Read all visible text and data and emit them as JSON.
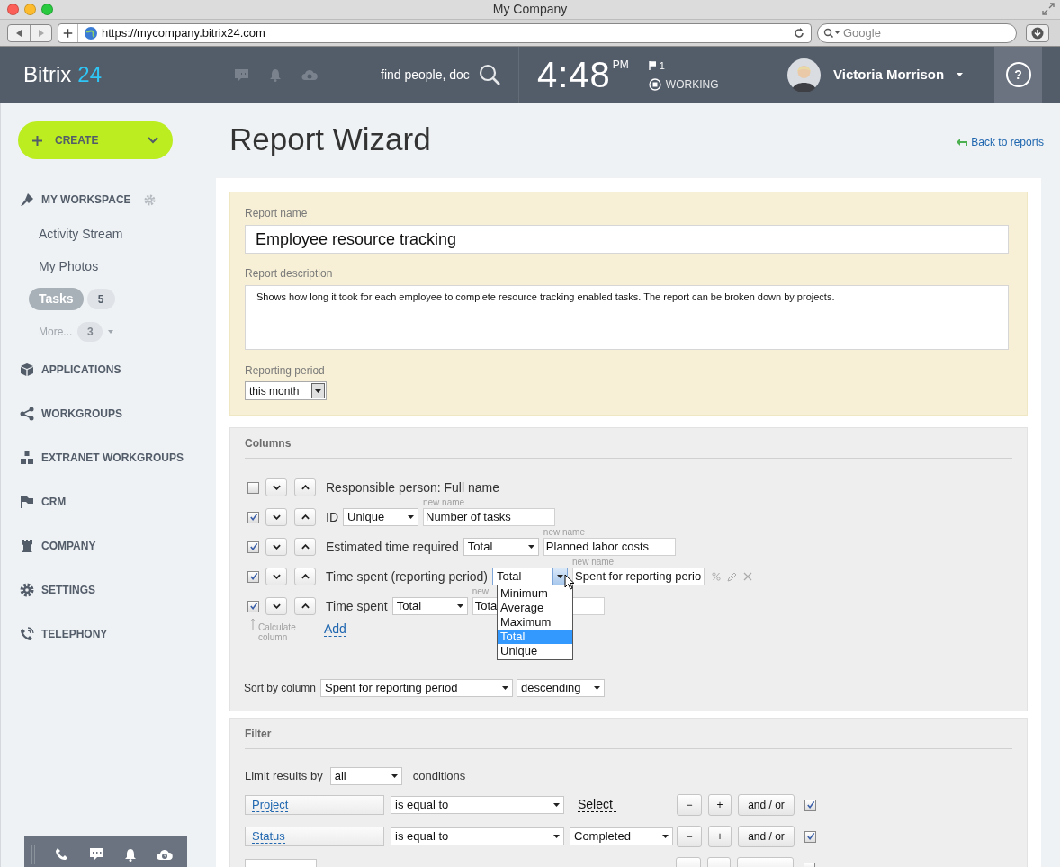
{
  "browser": {
    "title": "My Company",
    "url": "https://mycompany.bitrix24.com",
    "search_placeholder": "Google"
  },
  "header": {
    "logo": "Bitrix",
    "logo_number": "24",
    "search_placeholder": "find people, doc",
    "time": "4:48",
    "ampm": "PM",
    "flag_count": "1",
    "work_status": "WORKING",
    "user_name": "Victoria Morrison",
    "help": "?"
  },
  "sidebar": {
    "create": "CREATE",
    "workspace": "MY WORKSPACE",
    "workspace_items": [
      {
        "label": "Activity Stream",
        "selected": false
      },
      {
        "label": "My Photos",
        "selected": false
      },
      {
        "label": "Tasks",
        "count": "5",
        "selected": true
      }
    ],
    "more": {
      "label": "More...",
      "count": "3"
    },
    "sections": [
      {
        "label": "APPLICATIONS"
      },
      {
        "label": "WORKGROUPS"
      },
      {
        "label": "EXTRANET WORKGROUPS"
      },
      {
        "label": "CRM"
      },
      {
        "label": "COMPANY"
      },
      {
        "label": "SETTINGS"
      },
      {
        "label": "TELEPHONY"
      }
    ]
  },
  "page": {
    "title": "Report Wizard",
    "back_link": "Back to reports"
  },
  "report": {
    "name_label": "Report name",
    "name": "Employee resource tracking",
    "description_label": "Report description",
    "description": "Shows how long it took for each employee to complete resource tracking enabled tasks. The report can be broken down by projects.",
    "period_label": "Reporting period",
    "period": "this month"
  },
  "columns": {
    "title": "Columns",
    "rows": [
      {
        "label": "Responsible person: Full name",
        "checked": false
      },
      {
        "label": "ID",
        "aggregate": "Unique",
        "new_name_label": "new name",
        "new_name": "Number of tasks",
        "checked": true
      },
      {
        "label": "Estimated time required",
        "aggregate": "Total",
        "new_name_label": "new name",
        "new_name": "Planned labor costs",
        "checked": true
      },
      {
        "label": "Time spent (reporting period)",
        "aggregate": "Total",
        "new_name_label": "new name",
        "new_name": "Spent for reporting perio",
        "checked": true,
        "open": true,
        "actions": true
      },
      {
        "label": "Time spent",
        "aggregate": "Total",
        "new_name_label": "new",
        "new_name": "Tota",
        "checked": true
      }
    ],
    "dropdown_options": [
      {
        "label": "Minimum",
        "selected": false
      },
      {
        "label": "Average",
        "selected": false
      },
      {
        "label": "Maximum",
        "selected": false
      },
      {
        "label": "Total",
        "selected": true
      },
      {
        "label": "Unique",
        "selected": false
      }
    ],
    "calculate_label": "Calculate column",
    "add": "Add",
    "sort_label": "Sort by column",
    "sort_column": "Spent for reporting period",
    "sort_order": "descending"
  },
  "filter": {
    "title": "Filter",
    "limit_label": "Limit results by",
    "limit_value": "all",
    "conditions_label": "conditions",
    "rows": [
      {
        "kind": "condition",
        "field": "Project",
        "operator": "is equal to",
        "value_link": "Select",
        "minus": "−",
        "plus": "+",
        "and_or": "and / or",
        "checked": true
      },
      {
        "kind": "condition",
        "field": "Status",
        "operator": "is equal to",
        "value_select": "Completed",
        "minus": "−",
        "plus": "+",
        "and_or": "and / or",
        "checked": true
      },
      {
        "kind": "group",
        "checked": false
      }
    ]
  }
}
